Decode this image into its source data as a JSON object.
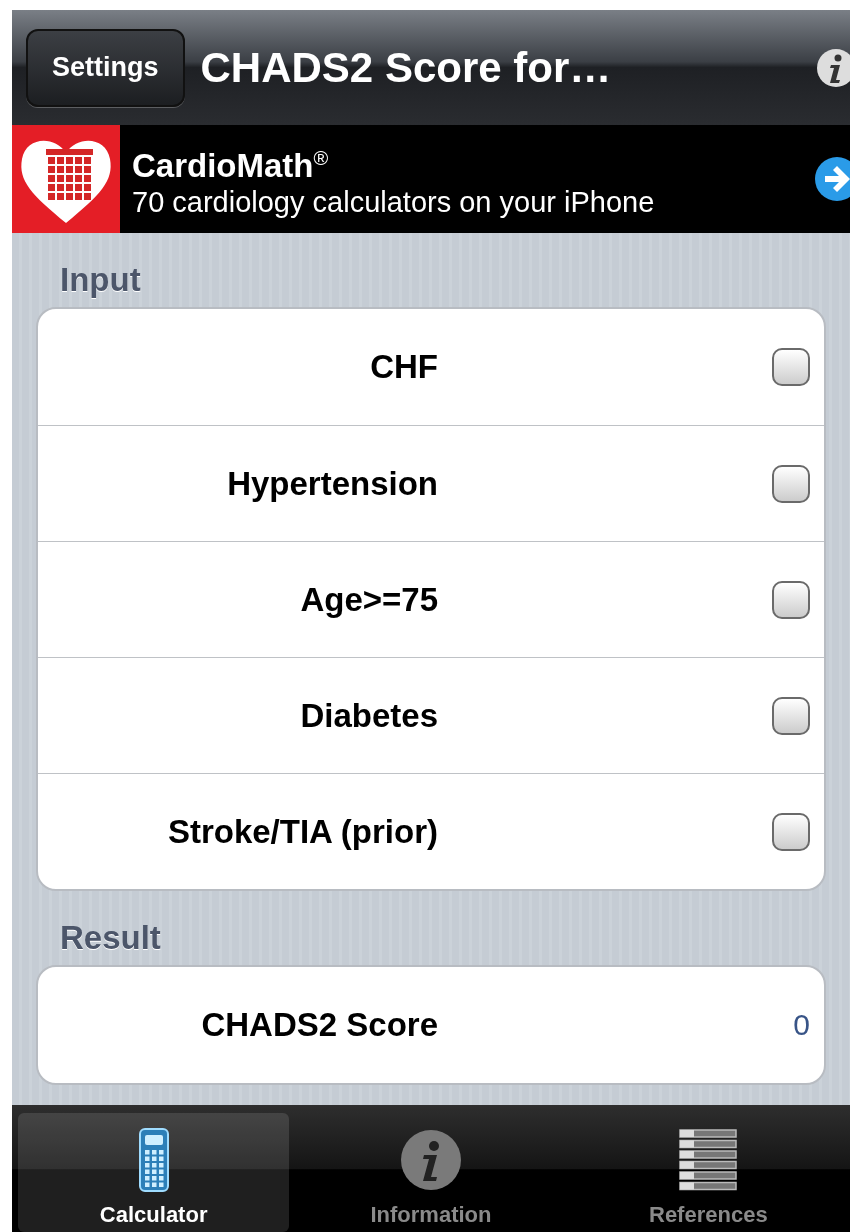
{
  "nav": {
    "back_button": "Settings",
    "title": "CHADS2 Score for…"
  },
  "ad": {
    "title": "CardioMath$^{®}$",
    "subtitle": "70 cardiology calculators on your iPhone"
  },
  "input": {
    "header": "Input",
    "rows": [
      {
        "label": "CHF",
        "checked": false
      },
      {
        "label": "Hypertension",
        "checked": false
      },
      {
        "label": "Age>=75",
        "checked": false
      },
      {
        "label": "Diabetes",
        "checked": false
      },
      {
        "label": "Stroke/TIA (prior)",
        "checked": false
      }
    ]
  },
  "result": {
    "header": "Result",
    "rows": [
      {
        "label": "CHADS2 Score",
        "value": "0"
      }
    ]
  },
  "tabs": [
    {
      "label": "Calculator",
      "selected": true
    },
    {
      "label": "Information",
      "selected": false
    },
    {
      "label": "References",
      "selected": false
    }
  ]
}
